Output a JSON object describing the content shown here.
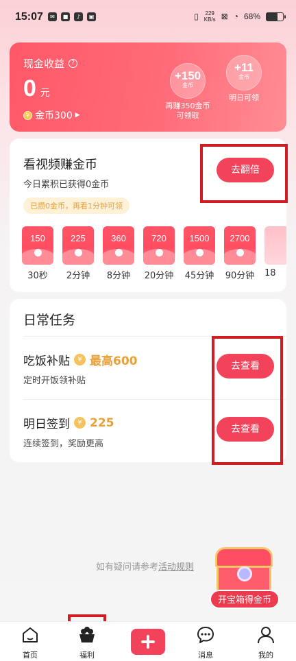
{
  "status_bar": {
    "time": "15:07",
    "left_icons": [
      "mail-icon",
      "app-icon",
      "tiktok-icon",
      "box-icon"
    ],
    "speed_value": "229",
    "speed_unit": "KB/s",
    "battery": "68%"
  },
  "earnings": {
    "title": "现金收益",
    "amount": "0",
    "unit": "元",
    "coins": "金币300",
    "bubbles": [
      {
        "num": "+150",
        "unit": "金币",
        "caption": "再赚350金币\n可领取"
      },
      {
        "num": "+11",
        "unit": "金币",
        "caption": "明日可领"
      }
    ]
  },
  "video_section": {
    "title": "看视频赚金币",
    "subtitle": "今日累积已获得0金币",
    "button": "去翻倍",
    "pill": "已攒0金币，再看1分钟可领",
    "envelopes": [
      {
        "coins": "150",
        "label": "30秒"
      },
      {
        "coins": "225",
        "label": "2分钟"
      },
      {
        "coins": "360",
        "label": "8分钟"
      },
      {
        "coins": "720",
        "label": "20分钟"
      },
      {
        "coins": "1500",
        "label": "45分钟"
      },
      {
        "coins": "2700",
        "label": "90分钟"
      },
      {
        "coins": "",
        "label": "18"
      }
    ]
  },
  "daily_tasks": {
    "title": "日常任务",
    "tasks": [
      {
        "name": "吃饭补贴",
        "reward": "最高600",
        "desc": "定时开饭领补贴",
        "button": "去查看"
      },
      {
        "name": "明日签到",
        "reward": "225",
        "desc": "连续签到，奖励更高",
        "button": "去查看"
      }
    ]
  },
  "rules": {
    "text": "如有疑问请参考",
    "link": "活动规则"
  },
  "chest": {
    "label": "开宝箱得金币"
  },
  "nav": {
    "items": [
      {
        "label": "首页",
        "icon": "home-icon"
      },
      {
        "label": "福利",
        "icon": "gift-basket-icon"
      },
      {
        "label": "",
        "icon": "plus-icon"
      },
      {
        "label": "消息",
        "icon": "chat-icon"
      },
      {
        "label": "我的",
        "icon": "profile-icon"
      }
    ]
  },
  "colors": {
    "accent": "#f2435a",
    "gold": "#e8a13a",
    "highlight_box": "#d01d24"
  }
}
